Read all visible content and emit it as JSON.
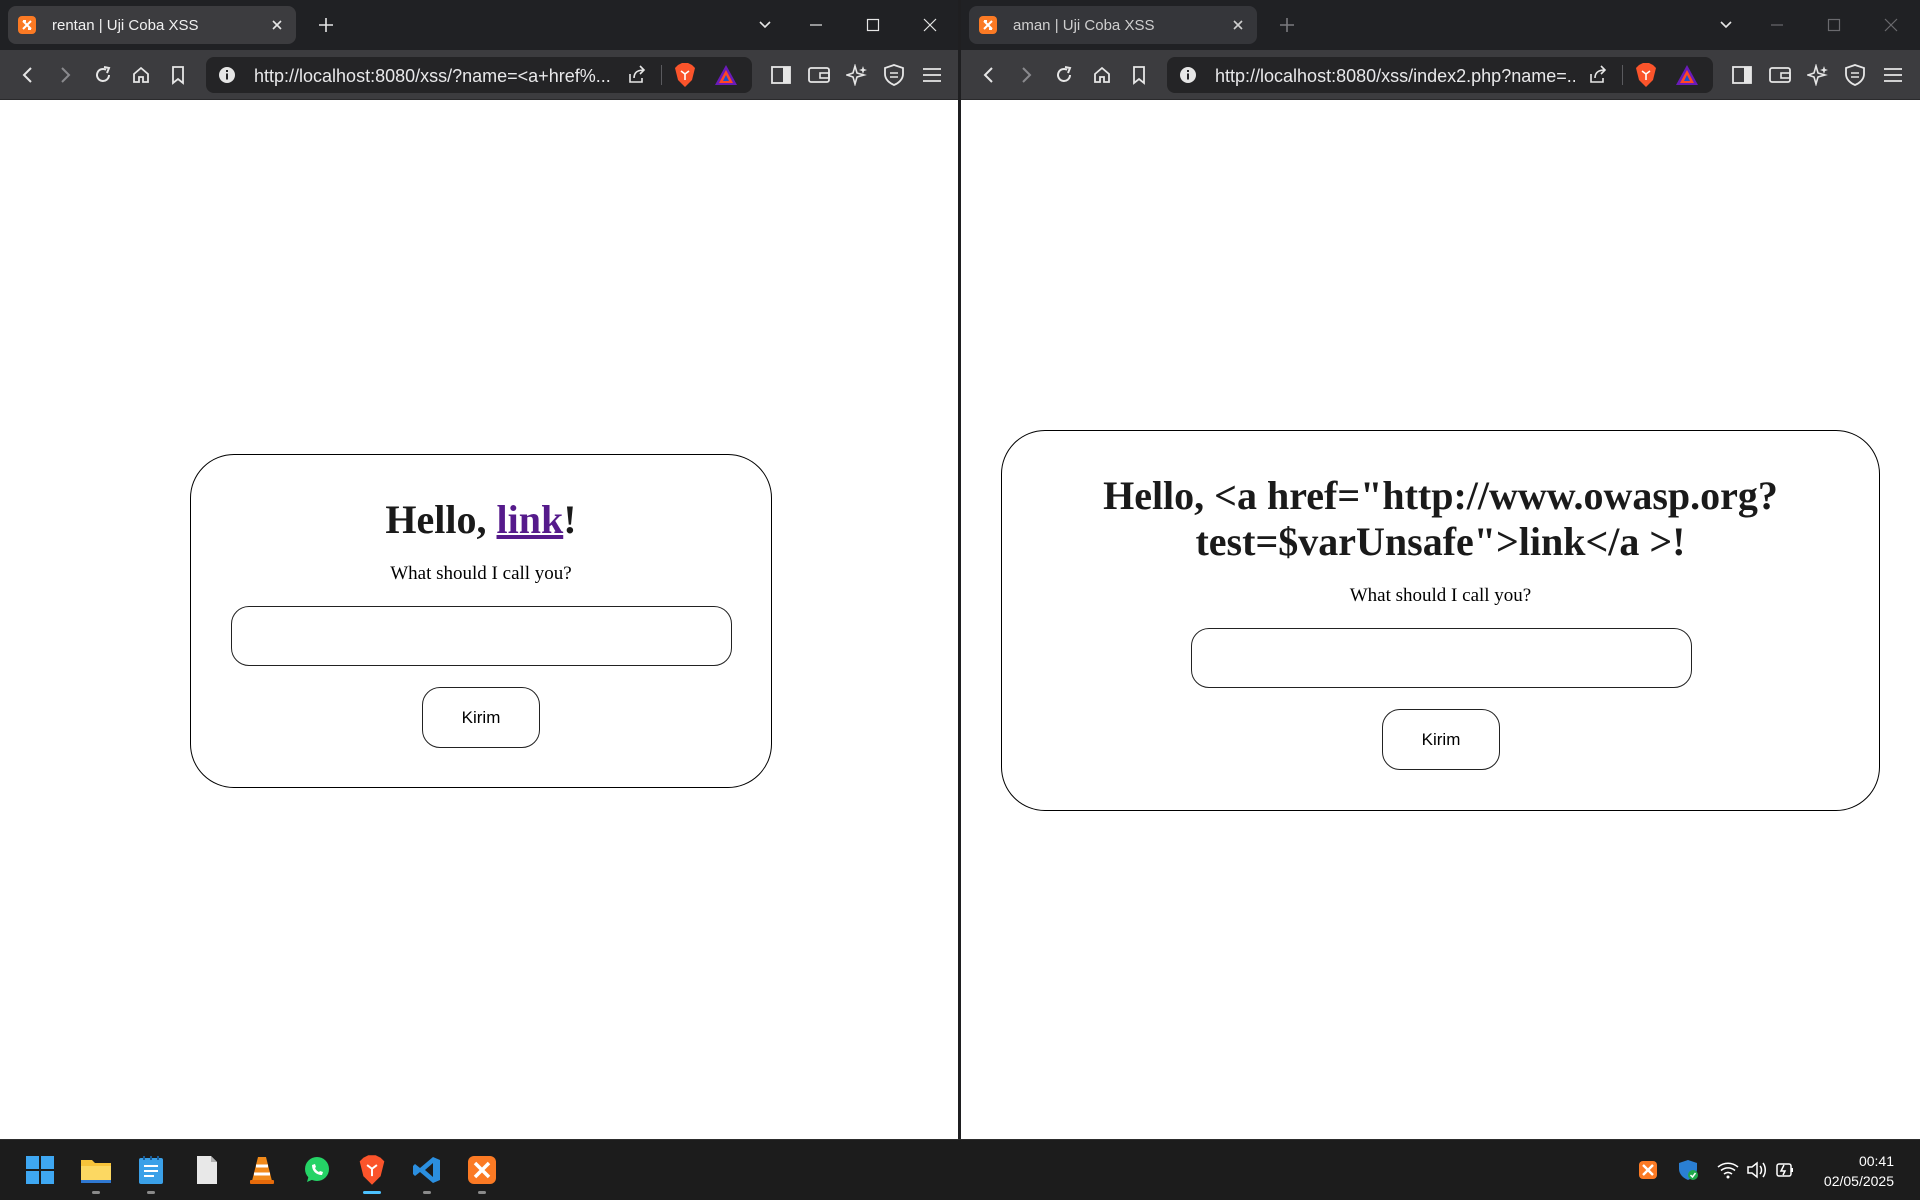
{
  "left_window": {
    "tab_title": "rentan | Uji Coba XSS",
    "url": "http://localhost:8080/xss/?name=<a+href%...",
    "page": {
      "hello_prefix": "Hello, ",
      "hello_link": "link",
      "hello_suffix": "!",
      "prompt": "What should I call you?",
      "input_value": "",
      "submit_label": "Kirim"
    }
  },
  "right_window": {
    "tab_title": "aman | Uji Coba XSS",
    "url": "http://localhost:8080/xss/index2.php?name=...",
    "page": {
      "hello_line1": "Hello, <a href=\"http://www.owasp.org?",
      "hello_line2": "test=$varUnsafe\">link</a >!",
      "prompt": "What should I call you?",
      "input_value": "",
      "submit_label": "Kirim"
    }
  },
  "taskbar": {
    "apps": [
      "start-icon",
      "file-explorer-icon",
      "notepad-icon",
      "document-icon",
      "vlc-icon",
      "whatsapp-icon",
      "brave-icon",
      "vscode-icon",
      "xampp-icon"
    ],
    "tray": [
      "xampp-icon",
      "security-icon",
      "wifi-icon",
      "volume-icon",
      "battery-icon"
    ],
    "time": "00:41",
    "date": "02/05/2025"
  }
}
